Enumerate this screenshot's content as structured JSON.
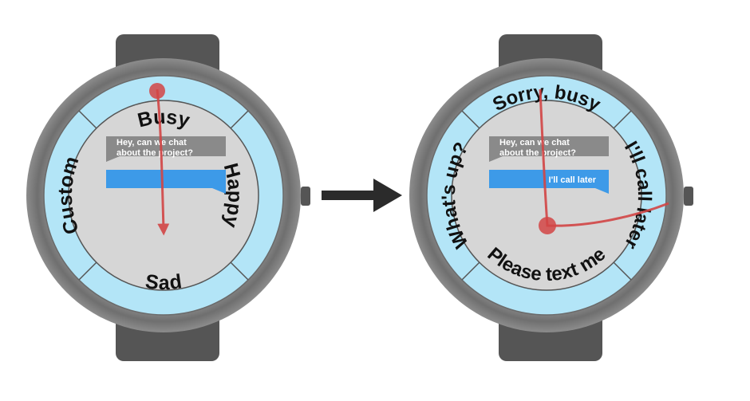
{
  "colors": {
    "band": "#555555",
    "bezel": "#8e8e8e",
    "ring": "#b3e5f7",
    "face": "#d6d6d6",
    "incoming_bubble": "#8a8a8a",
    "reply_bubble": "#3d9ae8",
    "gesture": "#d24545",
    "arrow": "#2b2b2b"
  },
  "watch_before": {
    "incoming_message": [
      "Hey, can we chat",
      "about the project?"
    ],
    "reply_text": "",
    "ring_labels": {
      "top": "Busy",
      "right": "Happy",
      "bottom": "Sad",
      "left": "Custom"
    }
  },
  "watch_after": {
    "incoming_message": [
      "Hey, can we chat",
      "about the project?"
    ],
    "reply_text": "I'll call later",
    "ring_labels": {
      "top": "Sorry, busy",
      "right": "I'll call later",
      "bottom": "Please text me",
      "left": "What's up?"
    }
  },
  "transition_arrow": "arrow-right-icon"
}
